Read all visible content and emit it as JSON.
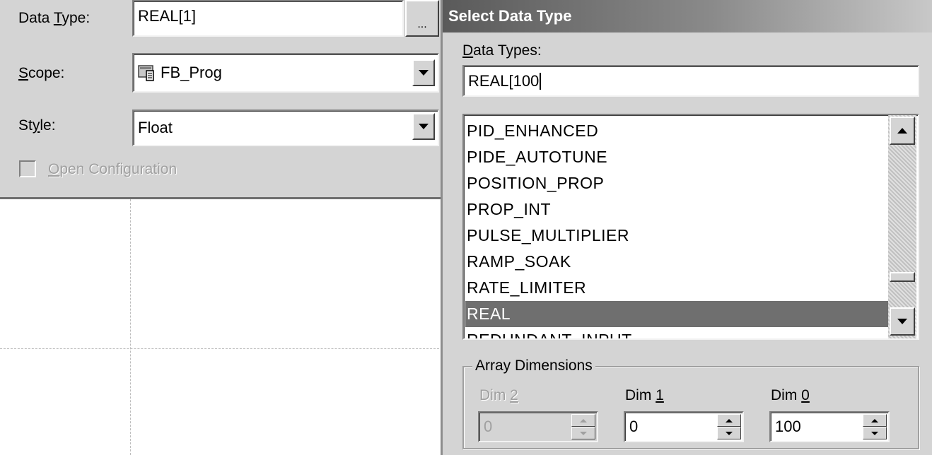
{
  "properties": {
    "data_type_label_pre": "Data ",
    "data_type_label_key": "T",
    "data_type_label_post": "ype:",
    "data_type_value": "REAL[1]",
    "browse_label": "...",
    "scope_label_key": "S",
    "scope_label_post": "cope:",
    "scope_value": "FB_Prog",
    "style_label_pre": "St",
    "style_label_key": "y",
    "style_label_post": "le:",
    "style_value": "Float",
    "open_config_key": "O",
    "open_config_post": "pen Configuration"
  },
  "dialog": {
    "title": "Select Data Type",
    "types_label_key": "D",
    "types_label_post": "ata Types:",
    "types_input": "REAL[100",
    "list_items": [
      "PID_ENHANCED",
      "PIDE_AUTOTUNE",
      "POSITION_PROP",
      "PROP_INT",
      "PULSE_MULTIPLIER",
      "RAMP_SOAK",
      "RATE_LIMITER",
      "REAL",
      "REDUNDANT_INPUT"
    ],
    "selected_item": "REAL",
    "array_dimensions": {
      "legend": "Array Dimensions",
      "dim2_label_pre": "Dim ",
      "dim2_label_key": "2",
      "dim2_value": "0",
      "dim1_label_pre": "Dim ",
      "dim1_label_key": "1",
      "dim1_value": "0",
      "dim0_label_pre": "Dim ",
      "dim0_label_key": "0",
      "dim0_value": "100"
    }
  },
  "icons": {
    "scope_icon": "program-scope-icon",
    "dropdown": "chevron-down-icon"
  }
}
